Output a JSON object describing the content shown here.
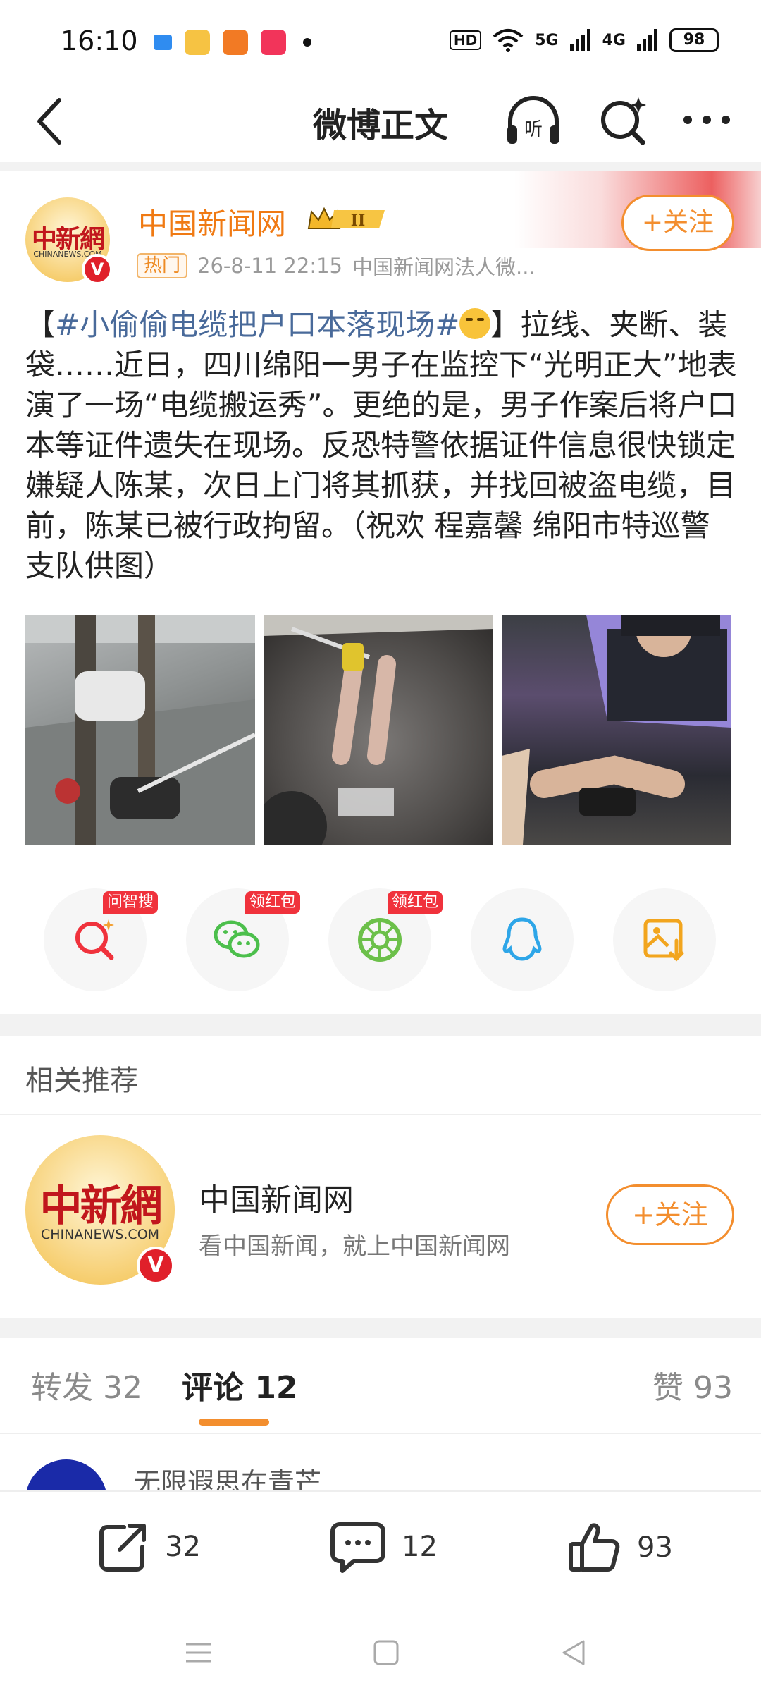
{
  "status_bar": {
    "time": "16:10",
    "hd_label": "HD",
    "net1": "5G",
    "net2": "4G",
    "battery": "98"
  },
  "nav": {
    "title": "微博正文"
  },
  "post": {
    "author": "中国新闻网",
    "avatar_logo_cn": "中新網",
    "avatar_logo_en": "CHINANEWS.COM",
    "level_badge": "II",
    "hot_label": "热门",
    "time": "26-8-11 22:15",
    "source": "中国新闻网法人微...",
    "follow_label": "+关注",
    "text_open": "【",
    "hashtag": "#小偷偷电缆把户口本落现场#",
    "text_close": "】拉线、夹断、装袋……近日，四川绵阳一男子在监控下“光明正大”地表演了一场“电缆搬运秀”。更绝的是，男子作案后将户口本等证件遗失在现场。反恐特警依据证件信息很快锁定嫌疑人陈某，次日上门将其抓获，并找回被盗电缆，目前，陈某已被行政拘留。（祝欢 程嘉馨 绵阳市特巡警支队供图）",
    "images": [
      "street-surveillance-photo",
      "cable-cutting-photo",
      "police-evidence-photo"
    ]
  },
  "share_row": [
    {
      "icon": "zhisou-search-icon",
      "badge": "问智搜",
      "color": "#f0323c"
    },
    {
      "icon": "wechat-icon",
      "badge": "领红包",
      "color": "#4cbf4c"
    },
    {
      "icon": "moments-icon",
      "badge": "领红包",
      "color": "#6cc04a"
    },
    {
      "icon": "qq-icon",
      "badge": "",
      "color": "#2ea6e8"
    },
    {
      "icon": "save-image-icon",
      "badge": "",
      "color": "#f2a51e"
    }
  ],
  "related": {
    "heading": "相关推荐",
    "name": "中国新闻网",
    "desc": "看中国新闻，就上中国新闻网",
    "follow_label": "+关注"
  },
  "tabs": {
    "repost": "转发 32",
    "comment": "评论 12",
    "like": "赞 93"
  },
  "comment_preview": {
    "user": "无限遐思在青芒"
  },
  "bottom_bar": {
    "repost_count": "32",
    "comment_count": "12",
    "like_count": "93"
  },
  "colors": {
    "accent": "#f38e2e",
    "hashtag": "#496a9a",
    "author": "#f07a13"
  }
}
